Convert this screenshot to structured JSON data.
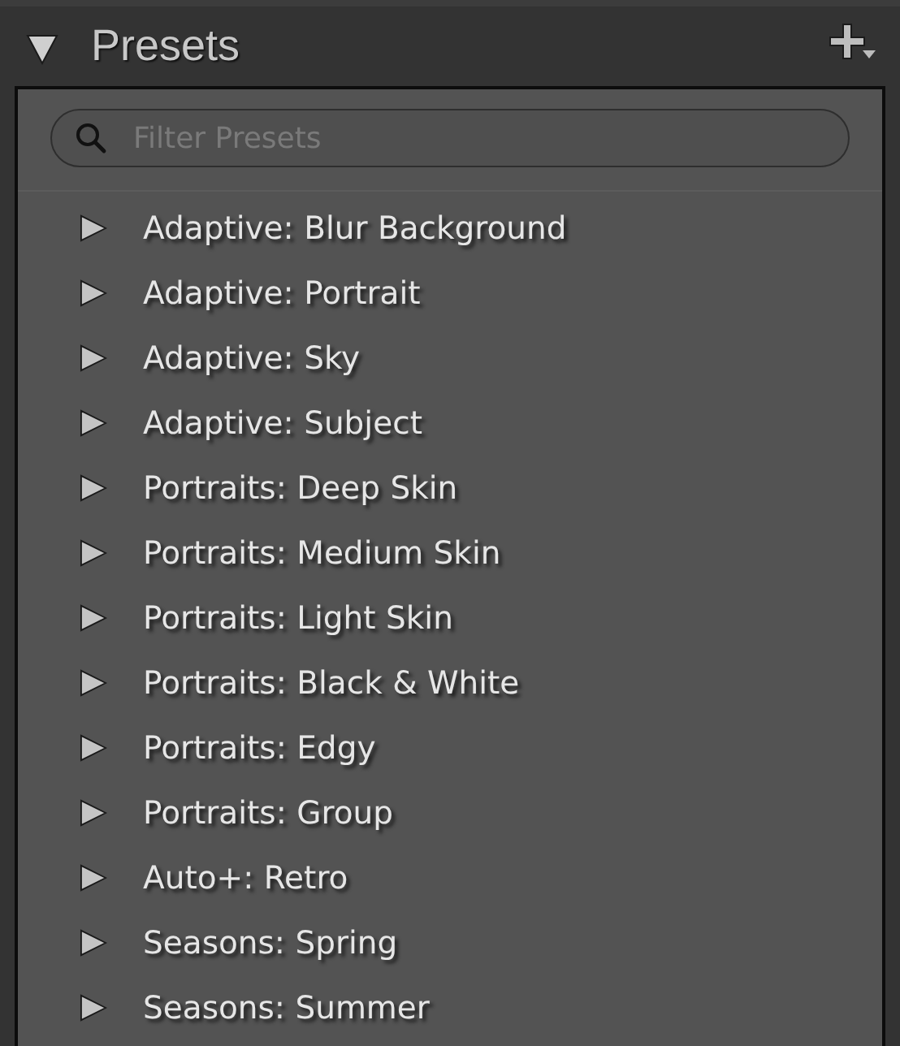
{
  "panel": {
    "title": "Presets",
    "expanded": true
  },
  "search": {
    "placeholder": "Filter Presets"
  },
  "presets": [
    {
      "label": "Adaptive: Blur Background",
      "expanded": false
    },
    {
      "label": "Adaptive: Portrait",
      "expanded": false
    },
    {
      "label": "Adaptive: Sky",
      "expanded": false
    },
    {
      "label": "Adaptive: Subject",
      "expanded": false
    },
    {
      "label": "Portraits: Deep Skin",
      "expanded": false
    },
    {
      "label": "Portraits: Medium Skin",
      "expanded": false
    },
    {
      "label": "Portraits: Light Skin",
      "expanded": false
    },
    {
      "label": "Portraits: Black & White",
      "expanded": false
    },
    {
      "label": "Portraits: Edgy",
      "expanded": false
    },
    {
      "label": "Portraits: Group",
      "expanded": false
    },
    {
      "label": "Auto+: Retro",
      "expanded": false
    },
    {
      "label": "Seasons: Spring",
      "expanded": false
    },
    {
      "label": "Seasons: Summer",
      "expanded": false
    }
  ]
}
